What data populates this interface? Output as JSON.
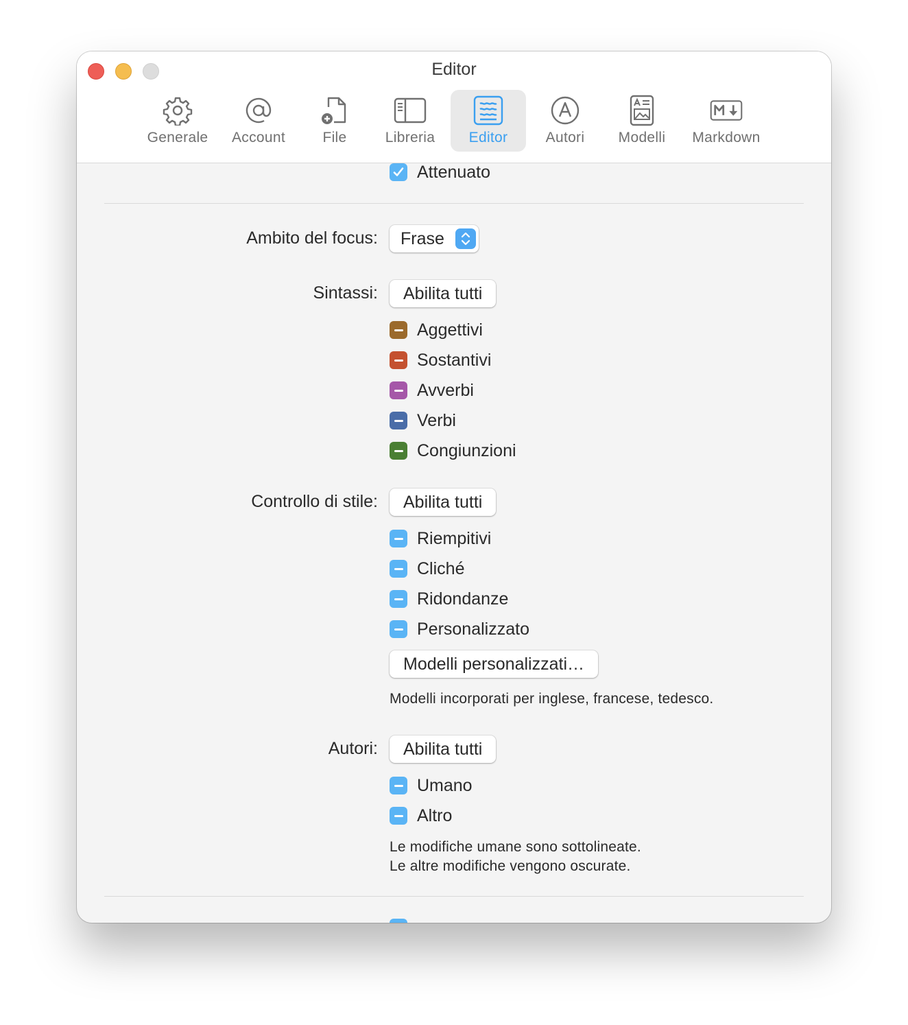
{
  "window": {
    "title": "Editor"
  },
  "toolbar": {
    "items": [
      {
        "label": "Generale",
        "icon": "gear-icon"
      },
      {
        "label": "Account",
        "icon": "at-icon"
      },
      {
        "label": "File",
        "icon": "file-add-icon"
      },
      {
        "label": "Libreria",
        "icon": "sidebar-icon"
      },
      {
        "label": "Editor",
        "icon": "editor-icon",
        "selected": true
      },
      {
        "label": "Autori",
        "icon": "author-icon"
      },
      {
        "label": "Modelli",
        "icon": "template-icon"
      },
      {
        "label": "Markdown",
        "icon": "markdown-icon"
      }
    ]
  },
  "attenuato": {
    "label": "Attenuato",
    "checked": true
  },
  "focus": {
    "label": "Ambito del focus:",
    "value": "Frase"
  },
  "sintassi": {
    "label": "Sintassi:",
    "button": "Abilita tutti",
    "items": [
      {
        "label": "Aggettivi",
        "color": "#9b6a2c"
      },
      {
        "label": "Sostantivi",
        "color": "#c4512f"
      },
      {
        "label": "Avverbi",
        "color": "#a557a8"
      },
      {
        "label": "Verbi",
        "color": "#4a6da8"
      },
      {
        "label": "Congiunzioni",
        "color": "#4a7f33"
      }
    ]
  },
  "stile": {
    "label": "Controllo di stile:",
    "button": "Abilita tutti",
    "items": [
      {
        "label": "Riempitivi",
        "color": "#5ab4f5"
      },
      {
        "label": "Cliché",
        "color": "#5ab4f5"
      },
      {
        "label": "Ridondanze",
        "color": "#5ab4f5"
      },
      {
        "label": "Personalizzato",
        "color": "#5ab4f5"
      }
    ],
    "custom_button": "Modelli personalizzati…",
    "note": "Modelli incorporati per inglese, francese, tedesco."
  },
  "autori": {
    "label": "Autori:",
    "button": "Abilita tutti",
    "items": [
      {
        "label": "Umano",
        "color": "#5ab4f5"
      },
      {
        "label": "Altro",
        "color": "#5ab4f5"
      }
    ],
    "note_line1": "Le modifiche umane sono sottolineate.",
    "note_line2": "Le altre modifiche vengono oscurate."
  },
  "colors": {
    "accent": "#3a9ff0",
    "checkbox_blue": "#5ab4f5"
  }
}
